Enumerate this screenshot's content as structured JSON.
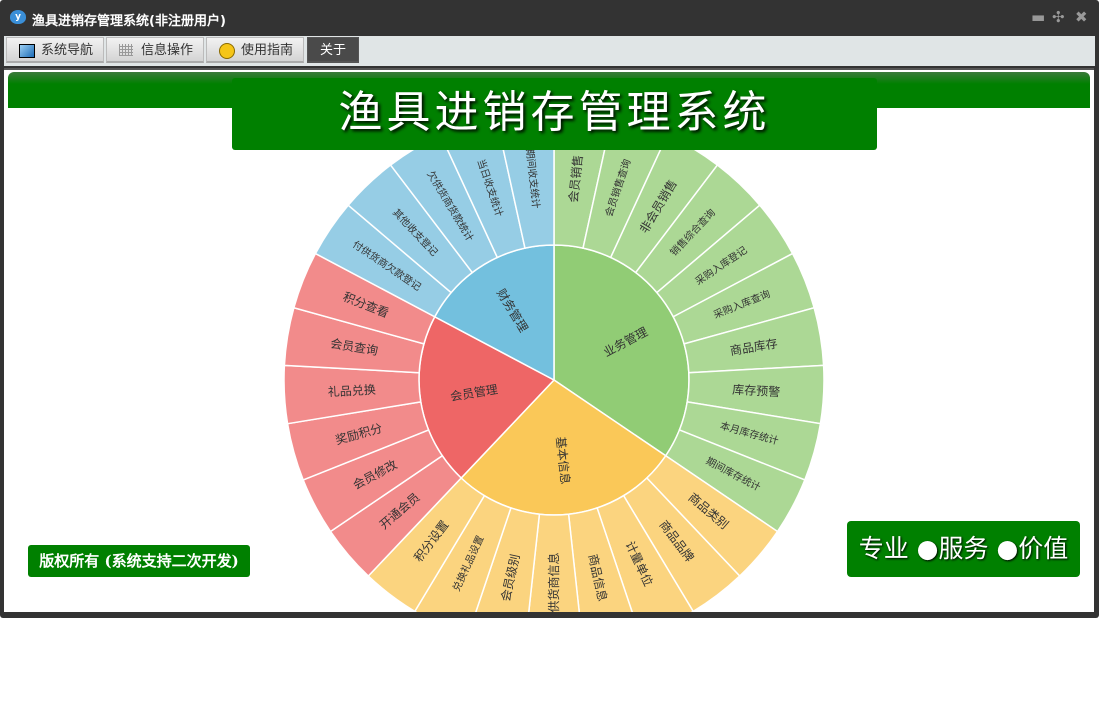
{
  "window": {
    "title": "渔具进销存管理系统(非注册用户)",
    "controls": {
      "minimize": "minimize-icon",
      "restore": "restore-icon",
      "close": "close-icon"
    }
  },
  "toolbar": {
    "tabs": [
      {
        "label": "系统导航",
        "icon": "monitor-icon"
      },
      {
        "label": "信息操作",
        "icon": "grid-icon"
      },
      {
        "label": "使用指南",
        "icon": "help-icon"
      },
      {
        "label": "关于",
        "active": true
      }
    ]
  },
  "banner": {
    "title": "渔具进销存管理系统"
  },
  "footer": {
    "copyright": "版权所有 (系统支持二次开发)",
    "slogan": "专业 ●服务 ●价值"
  },
  "sunburst": {
    "colors": {
      "业务管理": [
        "#91cc75",
        "#acd895"
      ],
      "基本信息": [
        "#fac858",
        "#fbd47f"
      ],
      "会员管理": [
        "#ee6666",
        "#f28b8b"
      ],
      "财务管理": [
        "#73c0de",
        "#96cde5"
      ]
    },
    "groups": [
      {
        "name": "业务管理",
        "children": [
          "会员销售",
          "会员销售查询",
          "非会员销售",
          "销售综合查询",
          "采购入库登记",
          "采购入库查询",
          "商品库存",
          "库存预警",
          "本月库存统计",
          "期间库存统计"
        ]
      },
      {
        "name": "基本信息",
        "children": [
          "商品类别",
          "商品品牌",
          "计量单位",
          "商品信息",
          "供货商信息",
          "会员级别",
          "兑换礼品设置",
          "积分设置"
        ]
      },
      {
        "name": "会员管理",
        "children": [
          "开通会员",
          "会员修改",
          "奖励积分",
          "礼品兑换",
          "会员查询",
          "积分查看"
        ]
      },
      {
        "name": "财务管理",
        "children": [
          "付供货商欠款登记",
          "其他收支登记",
          "欠供货商货款统计",
          "当日收支统计",
          "期间收支统计"
        ]
      }
    ]
  }
}
